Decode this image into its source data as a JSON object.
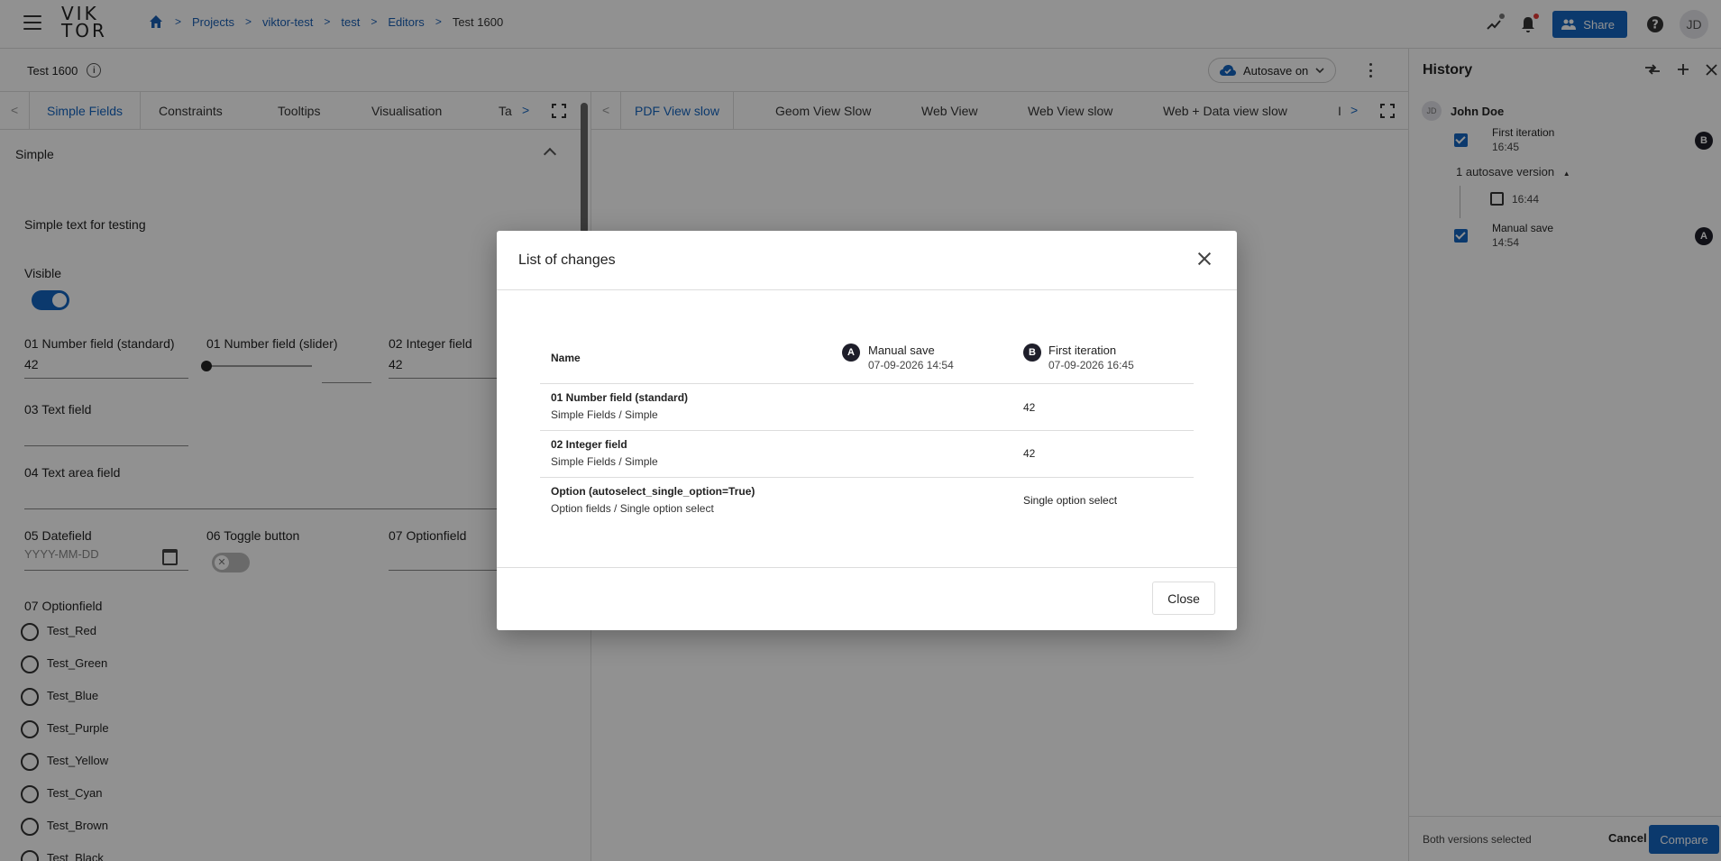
{
  "header": {
    "logo_line1": "VIK",
    "logo_line2": "TOR",
    "breadcrumb": [
      "Projects",
      "viktor-test",
      "test",
      "Editors"
    ],
    "breadcrumb_current": "Test 1600",
    "share_label": "Share",
    "user_initials": "JD",
    "colors": {
      "accent": "#1565c0",
      "notification_dot": "#e53935",
      "status_dot": "#777777"
    }
  },
  "subbar": {
    "entity_name": "Test 1600",
    "autosave_label": "Autosave on"
  },
  "left_tabs": [
    "Simple Fields",
    "Constraints",
    "Tooltips",
    "Visualisation",
    "Ta"
  ],
  "view_tabs": [
    "PDF View slow",
    "Geom View Slow",
    "Web View",
    "Web View slow",
    "Web + Data view slow",
    "I"
  ],
  "form": {
    "section": "Simple",
    "simple_text": "Simple text for testing",
    "visible_label": "Visible",
    "visible_on": true,
    "number_standard_label": "01 Number field (standard)",
    "number_standard_value": "42",
    "number_slider_label": "01 Number field (slider)",
    "integer_label": "02 Integer field",
    "integer_value": "42",
    "text_field_label": "03 Text field",
    "textarea_label": "04 Text area field",
    "datefield_label": "05 Datefield",
    "datefield_placeholder": "YYYY-MM-DD",
    "toggle_label": "06 Toggle button",
    "optionfield_label": "07 Optionfield",
    "optionfield2_label": "07 Optionfield",
    "options": [
      "Test_Red",
      "Test_Green",
      "Test_Blue",
      "Test_Purple",
      "Test_Yellow",
      "Test_Cyan",
      "Test_Brown",
      "Test_Black"
    ]
  },
  "history": {
    "title": "History",
    "user_initials": "JD",
    "user_name": "John Doe",
    "versions": [
      {
        "title": "First iteration",
        "time": "16:45",
        "badge": "B",
        "checked": true
      },
      {
        "title": "Manual save",
        "time": "14:54",
        "badge": "A",
        "checked": true
      }
    ],
    "autosave_toggle": "1 autosave version",
    "autosave_item_time": "16:44",
    "footer_text": "Both versions selected",
    "cancel_label": "Cancel",
    "compare_label": "Compare"
  },
  "modal": {
    "title": "List of changes",
    "name_header": "Name",
    "col_a": {
      "badge": "A",
      "title": "Manual save",
      "date": "07-09-2026 14:54"
    },
    "col_b": {
      "badge": "B",
      "title": "First iteration",
      "date": "07-09-2026 16:45"
    },
    "rows": [
      {
        "name": "01 Number field (standard)",
        "path": "Simple Fields / Simple",
        "a": "",
        "b": "42"
      },
      {
        "name": "02 Integer field",
        "path": "Simple Fields / Simple",
        "a": "",
        "b": "42"
      },
      {
        "name": "Option (autoselect_single_option=True)",
        "path": "Option fields / Single option select",
        "a": "",
        "b": "Single option select"
      }
    ],
    "close_label": "Close"
  }
}
